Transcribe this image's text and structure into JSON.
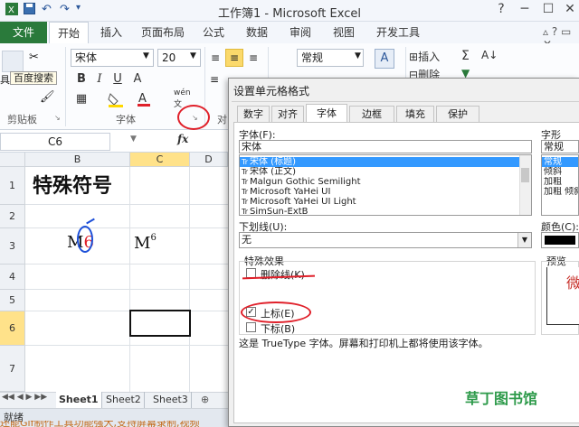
{
  "window": {
    "title": "工作簿1 - Microsoft Excel",
    "minimize": "─",
    "restore": "☐",
    "close": "✕"
  },
  "tabs": [
    {
      "label": "文件"
    },
    {
      "label": "开始"
    },
    {
      "label": "插入"
    },
    {
      "label": "页面布局"
    },
    {
      "label": "公式"
    },
    {
      "label": "数据"
    },
    {
      "label": "审阅"
    },
    {
      "label": "视图"
    },
    {
      "label": "开发工具"
    }
  ],
  "ribbon": {
    "font_name": "宋体",
    "font_size": "20",
    "number_format": "常规",
    "tooltip": "百度搜索",
    "paste_label": "具",
    "insert_label": "插入",
    "delete_label": "删除",
    "bold": "B",
    "italic": "I",
    "underline": "U",
    "sum": "Σ",
    "groups": {
      "clipboard": "剪贴板",
      "font": "字体",
      "alignment": "对"
    }
  },
  "formula_bar": {
    "name_box": "C6",
    "fx": "fx"
  },
  "grid": {
    "columns": [
      "B",
      "C",
      "D"
    ],
    "rows": [
      "1",
      "2",
      "3",
      "4",
      "5",
      "6",
      "7"
    ],
    "cells": {
      "B1": "特殊符号",
      "B3_base": "M",
      "B3_digit": "6",
      "C3_base": "M",
      "C3_sup": "6"
    }
  },
  "sheets": [
    "Sheet1",
    "Sheet2",
    "Sheet3"
  ],
  "status": {
    "ready": "就绪",
    "overlay": "还能Gif制作工具功能强大,支持屏幕录制,视频"
  },
  "dialog": {
    "title": "设置单元格格式",
    "tabs": [
      "数字",
      "对齐",
      "字体",
      "边框",
      "填充",
      "保护"
    ],
    "font_label": "字体(F):",
    "font_value": "宋体",
    "font_list": [
      "宋体 (标题)",
      "宋体 (正文)",
      "Malgun Gothic Semilight",
      "Microsoft YaHei UI",
      "Microsoft YaHei UI Light",
      "SimSun-ExtB"
    ],
    "style_label": "字形(O):",
    "style_value": "常规",
    "style_list": [
      "常规",
      "倾斜",
      "加粗",
      "加粗 倾斜"
    ],
    "underline_label": "下划线(U):",
    "underline_value": "无",
    "color_label": "颜色(C):",
    "effects_label": "特殊效果",
    "strikethrough": "删除线(K)",
    "superscript": "上标(E)",
    "subscript": "下标(B)",
    "superscript_checked": true,
    "preview_label": "预览",
    "preview_text": "微",
    "note": "这是 TrueType 字体。屏幕和打印机上都将使用该字体。"
  },
  "watermark": "草丁图书馆",
  "colors": {
    "excel_green": "#2a7a3b",
    "annotation_red": "#e0202a",
    "annotation_blue": "#1c4fd8",
    "selection_blue": "#3399ff"
  }
}
